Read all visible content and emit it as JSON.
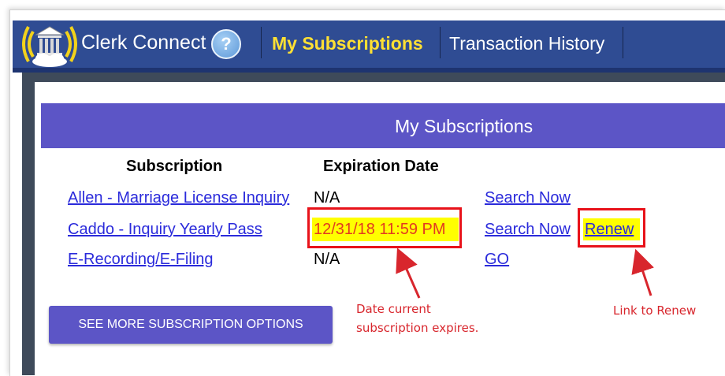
{
  "nav": {
    "brand": "Clerk Connect",
    "help_icon": "?",
    "tabs": [
      {
        "label": "My Subscriptions",
        "active": true
      },
      {
        "label": "Transaction History",
        "active": false
      }
    ]
  },
  "panel": {
    "title": "My Subscriptions",
    "columns": [
      "Subscription",
      "Expiration Date"
    ],
    "rows": [
      {
        "subscription": "Allen - Marriage License Inquiry",
        "expiration": "N/A",
        "action": "Search Now",
        "renew": ""
      },
      {
        "subscription": "Caddo - Inquiry Yearly Pass",
        "expiration": "12/31/18 11:59 PM",
        "action": "Search Now",
        "renew": "Renew"
      },
      {
        "subscription": "E-Recording/E-Filing",
        "expiration": "N/A",
        "action": "GO",
        "renew": ""
      }
    ],
    "more_button": "SEE MORE SUBSCRIPTION OPTIONS"
  },
  "annotations": {
    "date_line1": "Date current",
    "date_line2": "subscription expires.",
    "renew_note": "Link to Renew"
  },
  "colors": {
    "navbar": "#2f4c93",
    "active_tab": "#ffe033",
    "panel_header": "#5c55c6",
    "link": "#2a2adb",
    "highlight": "#ffff00",
    "annotation": "#d8262d"
  }
}
